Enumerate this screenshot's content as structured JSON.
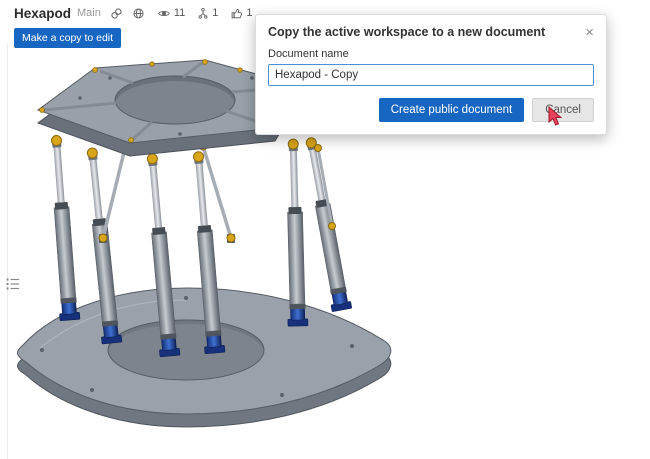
{
  "header": {
    "title": "Hexapod",
    "workspace": "Main",
    "views_count": "11",
    "forks_count": "1",
    "likes_count": "1"
  },
  "canvas": {
    "copy_edit_button": "Make a copy to edit"
  },
  "modal": {
    "title": "Copy the active workspace to a new document",
    "close_label": "×",
    "name_label": "Document name",
    "name_value": "Hexapod - Copy",
    "primary_label": "Create public document",
    "cancel_label": "Cancel"
  },
  "colors": {
    "primary_blue": "#1766c1",
    "accent_yellow": "#d9a51b",
    "joint_blue": "#1c3d8f",
    "plate_gray": "#9aa1aa"
  }
}
